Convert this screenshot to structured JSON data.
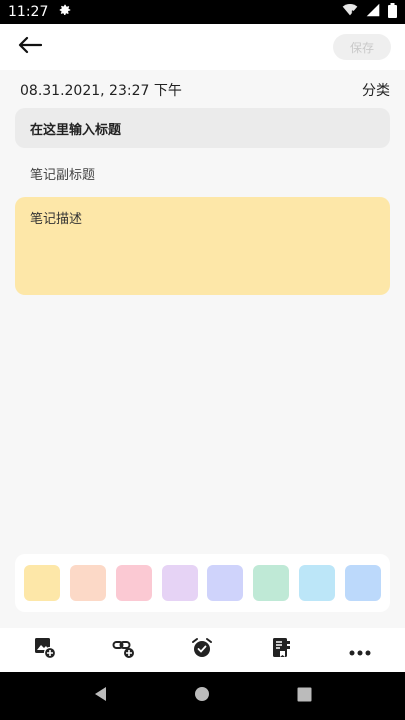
{
  "status_bar": {
    "time": "11:27",
    "icons": [
      "settings-icon",
      "wifi-icon",
      "signal-icon",
      "battery-icon"
    ]
  },
  "app_bar": {
    "back_icon": "arrow-left-icon",
    "save_label": "保存"
  },
  "meta": {
    "datetime": "08.31.2021, 23:27 下午",
    "category_label": "分类"
  },
  "note": {
    "title_placeholder": "在这里输入标题",
    "subtitle_placeholder": "笔记副标题",
    "description_placeholder": "笔记描述",
    "description_bg": "#fde7a8"
  },
  "palette": {
    "colors": [
      "#fde7a8",
      "#fcd9c7",
      "#fbc9d3",
      "#e6d3f5",
      "#cfd3fb",
      "#bfe9d6",
      "#bce6f8",
      "#bcd9fb"
    ]
  },
  "toolbar": {
    "tools": [
      "add-image-icon",
      "add-link-icon",
      "alarm-icon",
      "notebook-icon",
      "more-icon"
    ]
  },
  "nav_bar": {
    "buttons": [
      "back-triangle-icon",
      "home-circle-icon",
      "recents-square-icon"
    ]
  }
}
